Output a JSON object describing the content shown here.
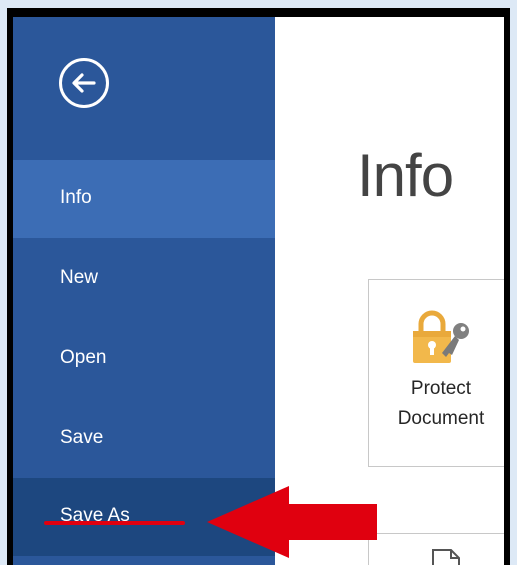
{
  "sidebar": {
    "back_icon": "back-arrow-circle-icon",
    "items": [
      {
        "label": "Info",
        "state": "selected"
      },
      {
        "label": "New",
        "state": "normal"
      },
      {
        "label": "Open",
        "state": "normal"
      },
      {
        "label": "Save",
        "state": "normal"
      },
      {
        "label": "Save As",
        "state": "hover"
      }
    ]
  },
  "main": {
    "title": "Info",
    "protect_tile": {
      "icon": "lock-key-icon",
      "line1": "Protect",
      "line2": "Document"
    },
    "second_tile": {
      "icon": "document-icon"
    }
  },
  "annotations": {
    "pointer": "red-arrow-icon",
    "underline": "red-underline"
  },
  "colors": {
    "sidebar": "#2b579a",
    "selected": "#3c6db5",
    "hover": "#1d477f",
    "annotation_red": "#e0000f",
    "outer_background": "#dde9f6",
    "border": "#000000"
  }
}
